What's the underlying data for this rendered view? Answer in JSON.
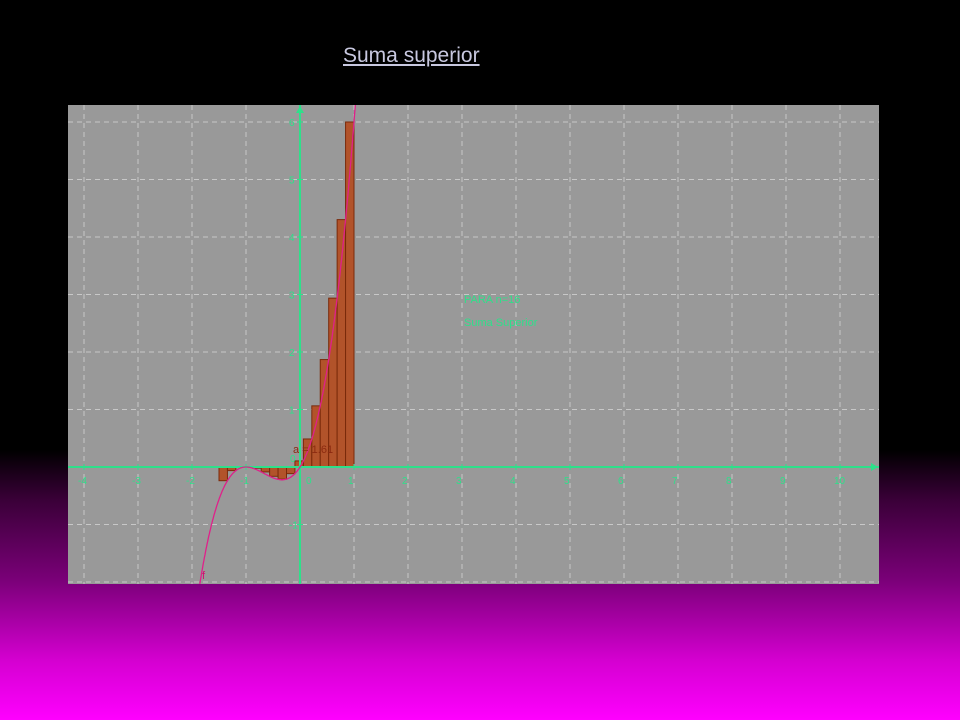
{
  "slide": {
    "title": "Suma superior"
  },
  "graph": {
    "x_ticks": [
      "-4",
      "-3",
      "-2",
      "-1",
      "0",
      "1",
      "2",
      "3",
      "4",
      "5",
      "6",
      "7",
      "8",
      "9",
      "10"
    ],
    "y_ticks": [
      "-1",
      "1",
      "2",
      "3",
      "4",
      "5",
      "6"
    ],
    "origin_label": "0",
    "function_label": "f",
    "area_label": "a = 1.61",
    "info_line1": "PARA n=16",
    "info_line2": "Suma Superior",
    "rectangles": {
      "n": 16,
      "from": -1.5,
      "to": 1
    },
    "colors": {
      "panel_bg": "#999999",
      "grid": "#c8c8c8",
      "axis": "#2ee08a",
      "curve": "#e0208a",
      "rect_fill": "#b2532a",
      "rect_stroke": "#7a2a0a",
      "area_label": "#8b2a10"
    }
  }
}
